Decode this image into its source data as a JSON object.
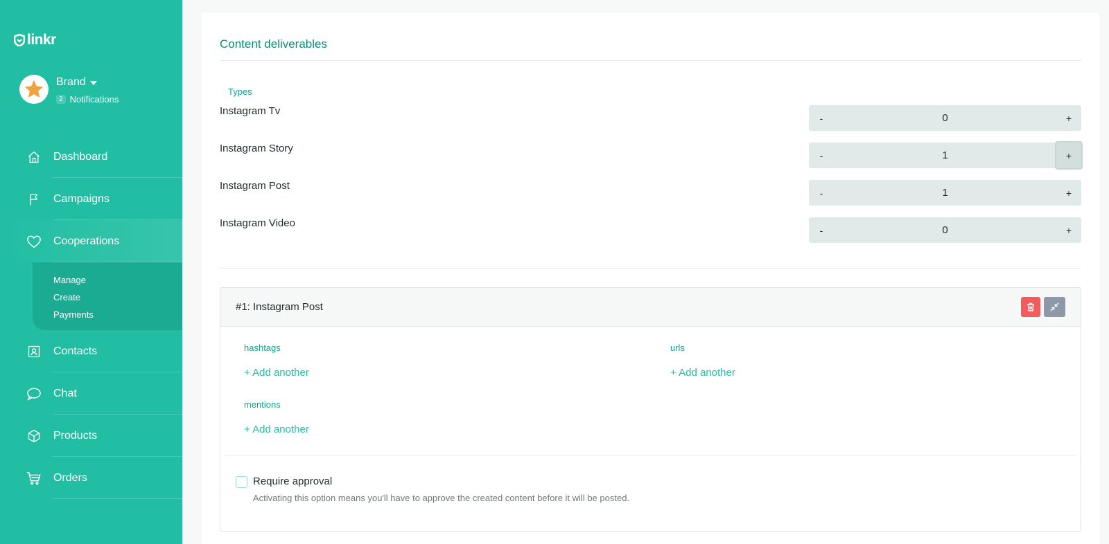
{
  "app": {
    "logo_text": "linkr"
  },
  "profile": {
    "name": "Brand",
    "notification_count": "2",
    "notifications_label": "Notifications"
  },
  "sidebar": {
    "items": [
      {
        "label": "Dashboard",
        "icon": "home-icon"
      },
      {
        "label": "Campaigns",
        "icon": "flag-icon"
      },
      {
        "label": "Cooperations",
        "icon": "heart-icon"
      },
      {
        "label": "Contacts",
        "icon": "contact-card-icon"
      },
      {
        "label": "Chat",
        "icon": "chat-bubble-icon"
      },
      {
        "label": "Products",
        "icon": "box-icon"
      },
      {
        "label": "Orders",
        "icon": "cart-icon"
      }
    ],
    "submenu": [
      "Manage",
      "Create",
      "Payments"
    ]
  },
  "content": {
    "title": "Content deliverables",
    "types_label": "Types",
    "types": [
      {
        "name": "Instagram Tv",
        "value": "0"
      },
      {
        "name": "Instagram Story",
        "value": "1"
      },
      {
        "name": "Instagram Post",
        "value": "1"
      },
      {
        "name": "Instagram Video",
        "value": "0"
      }
    ],
    "stepper": {
      "minus": "-",
      "plus": "+"
    },
    "deliverable": {
      "title": "#1: Instagram Post",
      "hashtags_label": "hashtags",
      "urls_label": "urls",
      "mentions_label": "mentions",
      "add_another": "+ Add another",
      "require_approval_label": "Require approval",
      "require_approval_help": "Activating this option means you'll have to approve the created content before it will be posted.",
      "require_approval_checked": false
    }
  },
  "colors": {
    "brand": "#21bea3",
    "delete": "#f25c5c",
    "collapse": "#8d99a8"
  }
}
